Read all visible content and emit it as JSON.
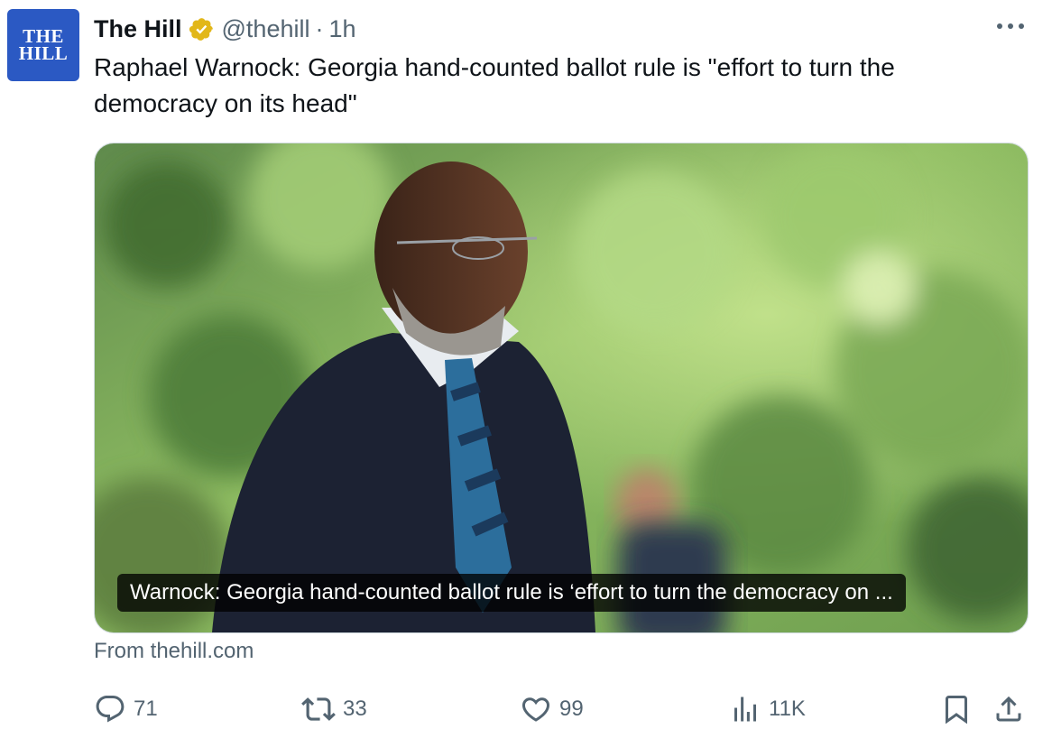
{
  "author": {
    "display_name": "The Hill",
    "handle": "@thehill",
    "separator": "·",
    "time": "1h",
    "avatar_line1": "THE",
    "avatar_line2": "HILL"
  },
  "tweet": {
    "text": "Raphael Warnock: Georgia hand-counted ballot rule is \"effort to turn the democracy on its head\""
  },
  "card": {
    "title": "Warnock: Georgia hand-counted ballot rule is ‘effort to turn the democracy on ...",
    "source": "From thehill.com"
  },
  "actions": {
    "replies": "71",
    "reposts": "33",
    "likes": "99",
    "views": "11K"
  },
  "icons": {
    "verified": "verified-badge-icon",
    "more": "more-icon",
    "reply": "reply-icon",
    "repost": "repost-icon",
    "like": "heart-icon",
    "views": "views-icon",
    "bookmark": "bookmark-icon",
    "share": "share-icon"
  },
  "colors": {
    "avatar_bg": "#2b59c3",
    "verified_gold": "#e2b719",
    "secondary_text": "#536471",
    "primary_text": "#0f1419"
  }
}
